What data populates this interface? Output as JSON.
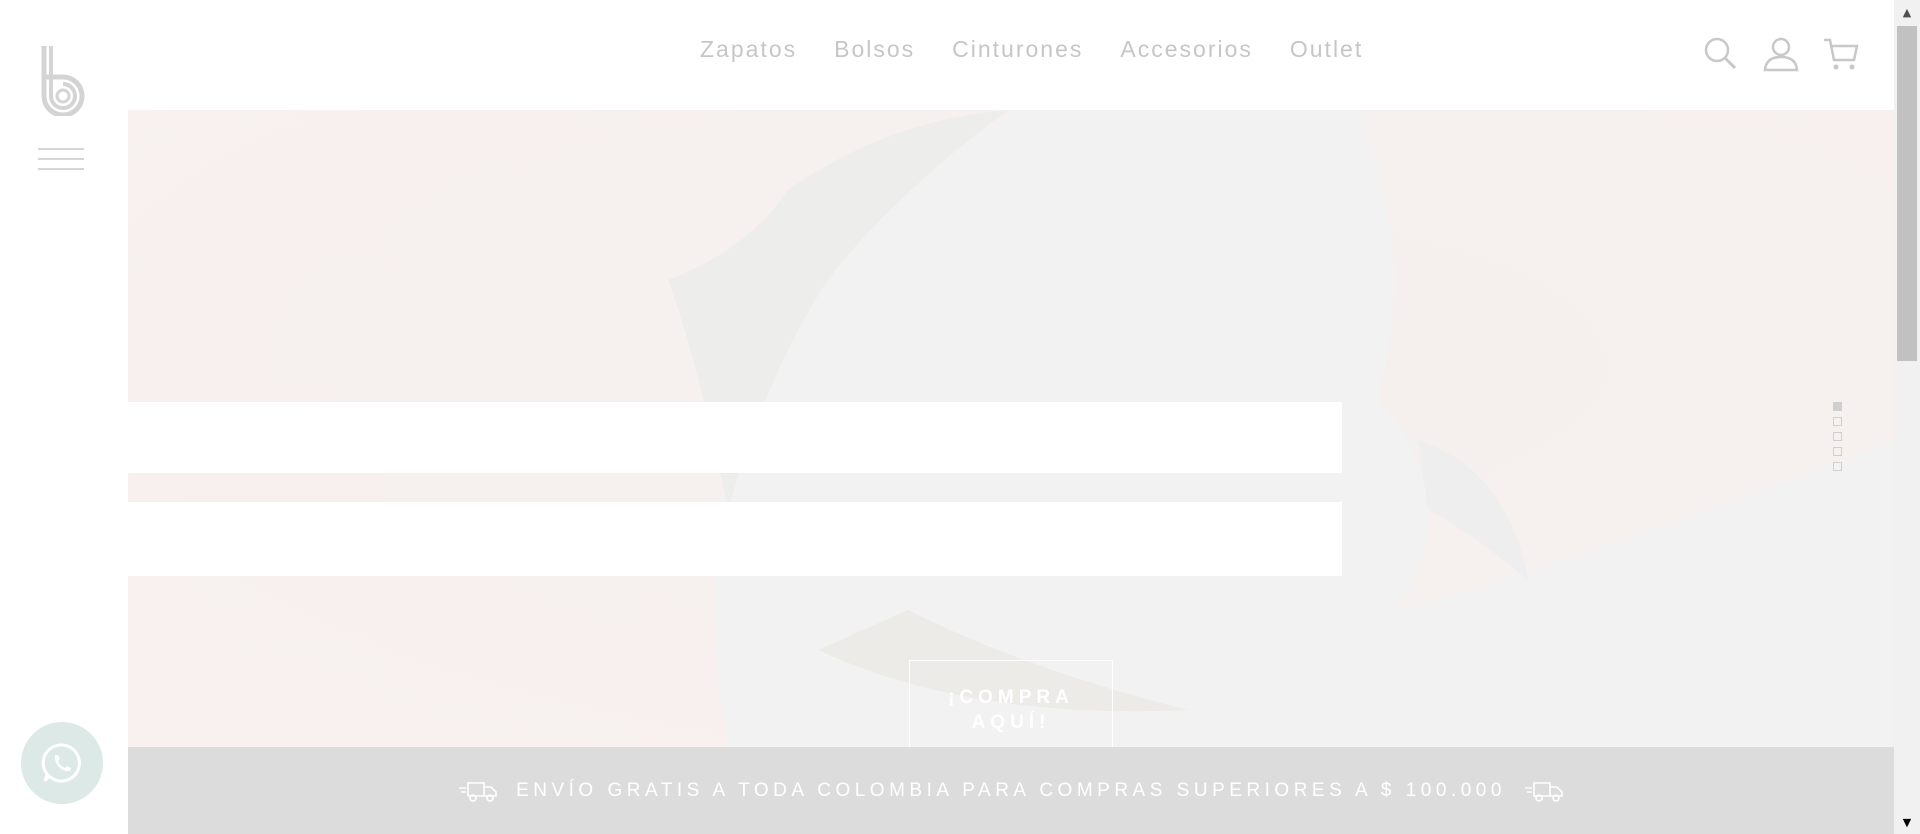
{
  "brand": {
    "logo_letter": "b"
  },
  "nav": {
    "items": [
      {
        "label": "Zapatos"
      },
      {
        "label": "Bolsos"
      },
      {
        "label": "Cinturones"
      },
      {
        "label": "Accesorios"
      },
      {
        "label": "Outlet"
      }
    ],
    "icons": [
      "search-icon",
      "user-icon",
      "cart-icon"
    ]
  },
  "hero": {
    "cta_line1": "¡COMPRA",
    "cta_line2": "AQUÍ!",
    "slides_total": 5,
    "active_slide": 1
  },
  "banner": {
    "text": "ENVÍO GRATIS A TODA COLOMBIA PARA COMPRAS SUPERIORES A $ 100.000"
  },
  "colors": {
    "nav_text": "#c6c6c6",
    "banner_bg": "#dcdcdc",
    "hero_bg": "#f6f0ee",
    "whatsapp_bg": "#dde9e7"
  }
}
